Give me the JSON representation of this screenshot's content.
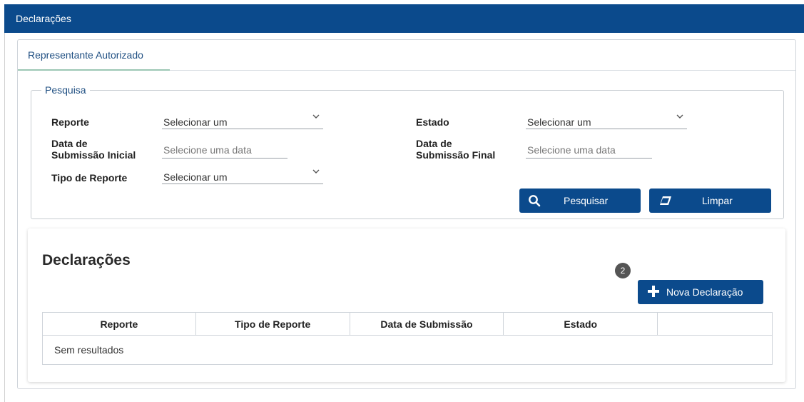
{
  "header": {
    "title": "Declarações"
  },
  "tabs": [
    {
      "label": "Representante Autorizado",
      "active": true
    }
  ],
  "search": {
    "legend": "Pesquisa",
    "fields": {
      "reporte": {
        "label": "Reporte",
        "value": "Selecionar um"
      },
      "estado": {
        "label": "Estado",
        "value": "Selecionar um"
      },
      "data_inicial": {
        "label_line1": "Data de",
        "label_line2": "Submissão Inicial",
        "placeholder": "Selecione uma data"
      },
      "data_final": {
        "label_line1": "Data de",
        "label_line2": "Submissão Final",
        "placeholder": "Selecione uma data"
      },
      "tipo_reporte": {
        "label": "Tipo de Reporte",
        "value": "Selecionar um"
      }
    },
    "buttons": {
      "search_label": "Pesquisar",
      "clear_label": "Limpar"
    }
  },
  "results": {
    "title": "Declarações",
    "badge": "2",
    "new_button_label": "Nova Declaração",
    "columns": [
      "Reporte",
      "Tipo de Reporte",
      "Data de Submissão",
      "Estado",
      ""
    ],
    "empty_text": "Sem resultados"
  },
  "colors": {
    "primary": "#0b4a8c",
    "tab_accent": "#9cc7b4"
  },
  "icons": {
    "search": "search-icon",
    "clear": "eraser-icon",
    "add": "plus-icon",
    "dropdown": "chevron-down-icon"
  }
}
